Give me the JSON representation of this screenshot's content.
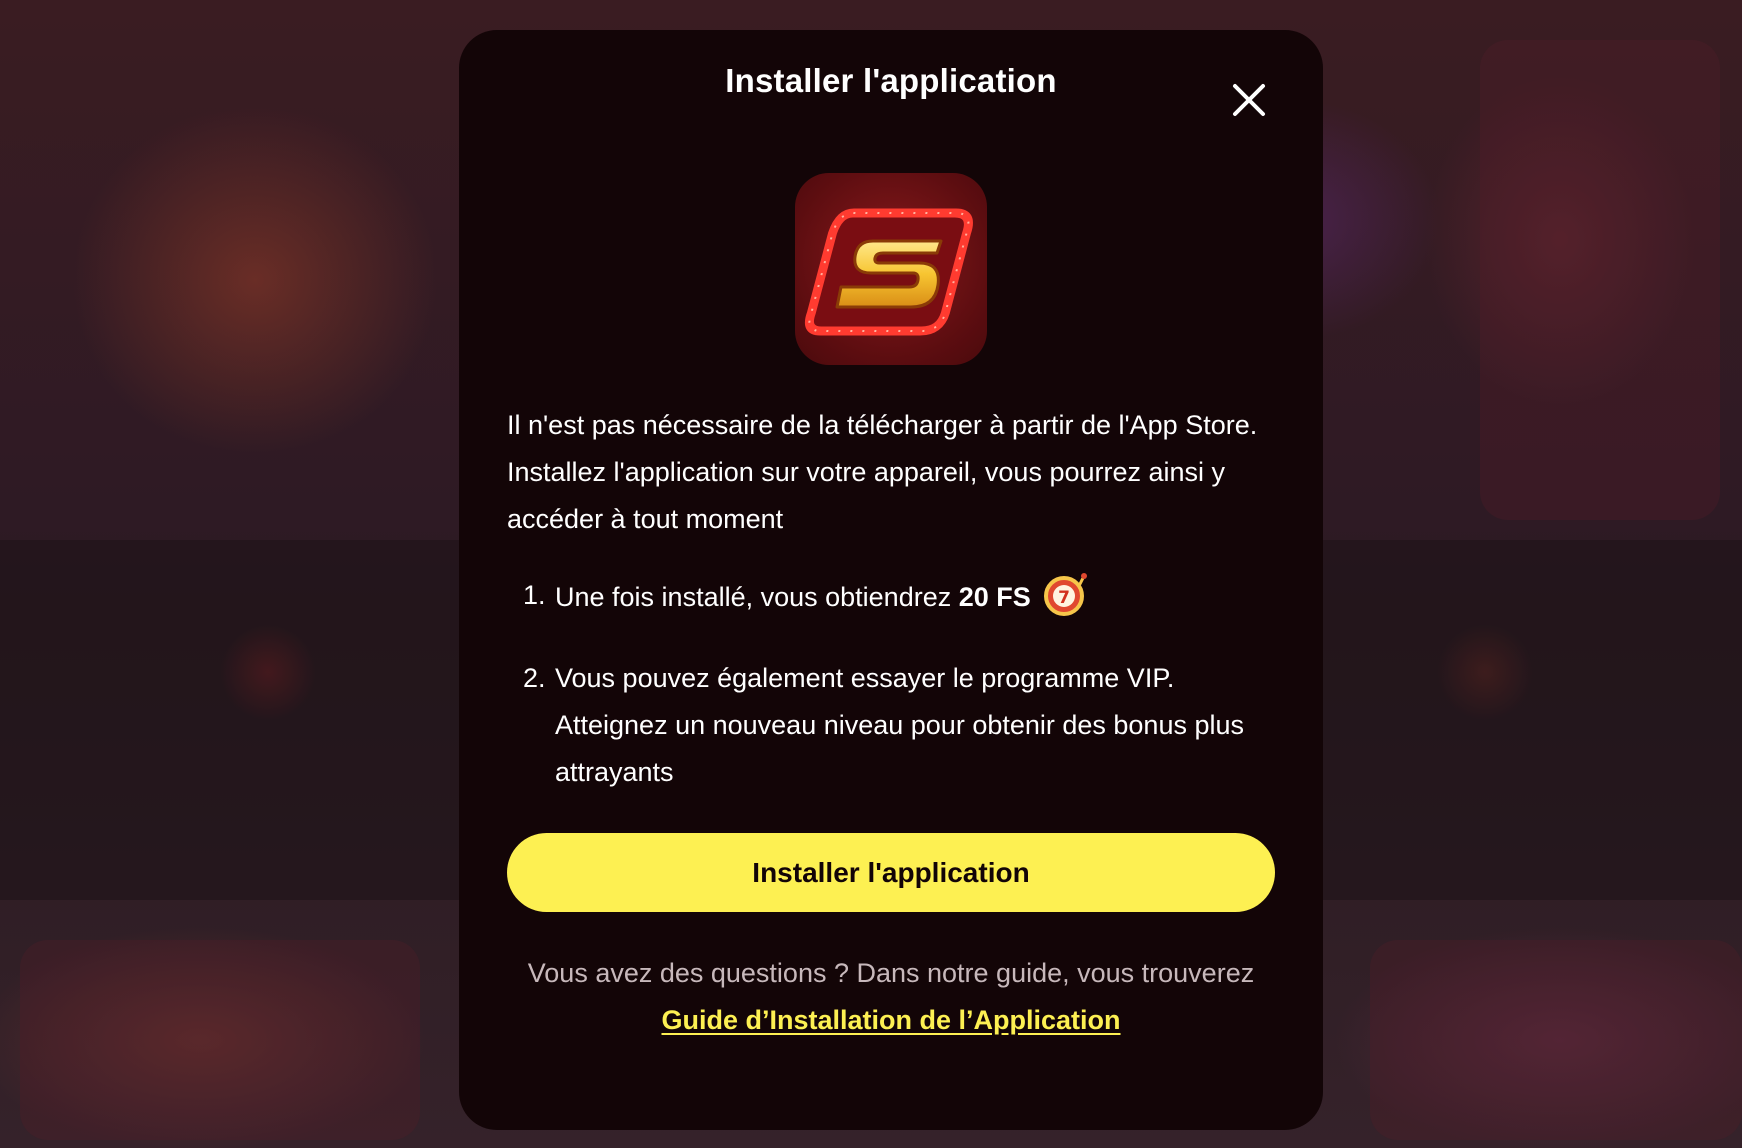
{
  "modal": {
    "title": "Installer l'application",
    "close_icon": "close-icon",
    "app_icon": "app-logo-icon",
    "description": "Il n'est pas nécessaire de la télécharger à partir de l'App Store. Installez l'application sur votre appareil, vous pourrez ainsi y accéder à tout moment",
    "steps": [
      {
        "number": "1.",
        "text_before": "Une fois installé, vous obtiendrez ",
        "bold": "20 FS",
        "icon": "slot-machine-icon"
      },
      {
        "number": "2.",
        "text": "Vous pouvez également essayer le programme VIP. Atteignez un nouveau niveau pour obtenir des bonus plus attrayants"
      }
    ],
    "install_button": "Installer l'application",
    "questions_text": "Vous avez des questions ? Dans notre guide, vous trouverez",
    "guide_link": "Guide d’Installation de l’Application"
  },
  "colors": {
    "modal_bg": "#130507",
    "button_bg": "#fdf052",
    "link": "#fdf052",
    "muted_text": "#c7b8bb",
    "backdrop": "#3a1a22"
  }
}
